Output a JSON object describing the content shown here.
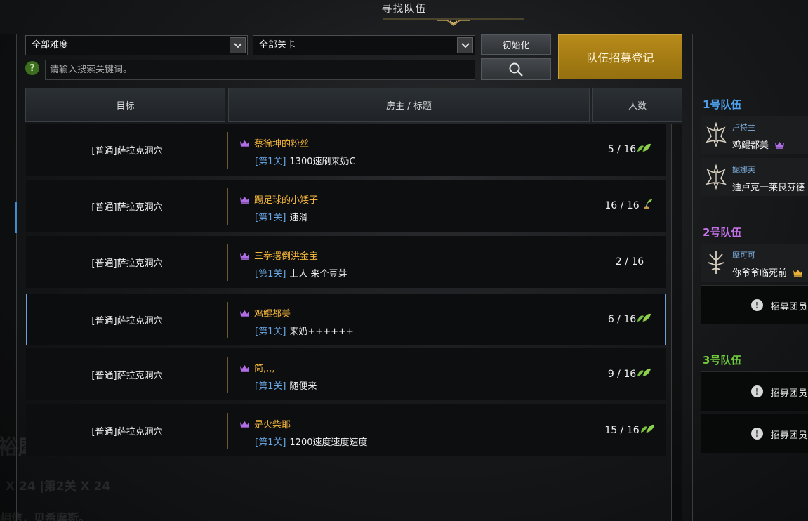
{
  "window": {
    "title": "寻找队伍"
  },
  "filters": {
    "difficulty_selected": "全部难度",
    "stage_selected": "全部关卡",
    "reset_label": "初始化",
    "register_label": "队伍招募登记",
    "search_placeholder": "请输入搜索关键词。",
    "help_symbol": "?"
  },
  "table": {
    "headers": [
      "目标",
      "房主 / 标题",
      "人数"
    ],
    "rows": [
      {
        "target": "[普通]萨拉克洞穴",
        "host": "蔡徐坤的粉丝",
        "stage": "[第1关]",
        "title": "1300速刷来奶C",
        "count": "5 / 16",
        "icon": "leaf-icon"
      },
      {
        "target": "[普通]萨拉克洞穴",
        "host": "踢足球的小矮子",
        "stage": "[第1关]",
        "title": "速滑",
        "count": "16 / 16",
        "icon": "sprout-icon"
      },
      {
        "target": "[普通]萨拉克洞穴",
        "host": "三拳撂倒洪金宝",
        "stage": "[第1关]",
        "title": "上人 来个豆芽",
        "count": "2 / 16",
        "icon": ""
      },
      {
        "target": "[普通]萨拉克洞穴",
        "host": "鸡鲲都美",
        "stage": "[第1关]",
        "title": "来奶++++++",
        "count": "6 / 16",
        "icon": "leaf-icon",
        "selected": true
      },
      {
        "target": "[普通]萨拉克洞穴",
        "host": "简,,,,",
        "stage": "[第1关]",
        "title": "随便来",
        "count": "9 / 16",
        "icon": "leaf-icon"
      },
      {
        "target": "[普通]萨拉克洞穴",
        "host": "是火柴耶",
        "stage": "[第1关]",
        "title": "1200速度速度速度",
        "count": "15 / 16",
        "icon": "leaf-icon"
      }
    ]
  },
  "teams": [
    {
      "label": "1号队伍",
      "color": "#4ea3f0",
      "members": [
        {
          "name": "卢特兰",
          "title": "鸡鲲都美",
          "crown": "purple"
        },
        {
          "name": "妮娜芙",
          "title": "迪卢克一莱艮芬德",
          "crown": ""
        }
      ],
      "recruit_slots": []
    },
    {
      "label": "2号队伍",
      "color": "#c572e8",
      "members": [
        {
          "name": "摩可可",
          "title": "你爷爷临死前",
          "crown": "gold"
        }
      ],
      "recruit_slots": [
        "招募团员"
      ]
    },
    {
      "label": "3号队伍",
      "color": "#6fcb3a",
      "members": [],
      "recruit_slots": [
        "招募团员",
        "招募团员"
      ]
    }
  ],
  "background_text": {
    "large": "裕摩斯",
    "mid": "X 24 |第2关 X 24",
    "small": "相信，贝希摩斯。"
  }
}
